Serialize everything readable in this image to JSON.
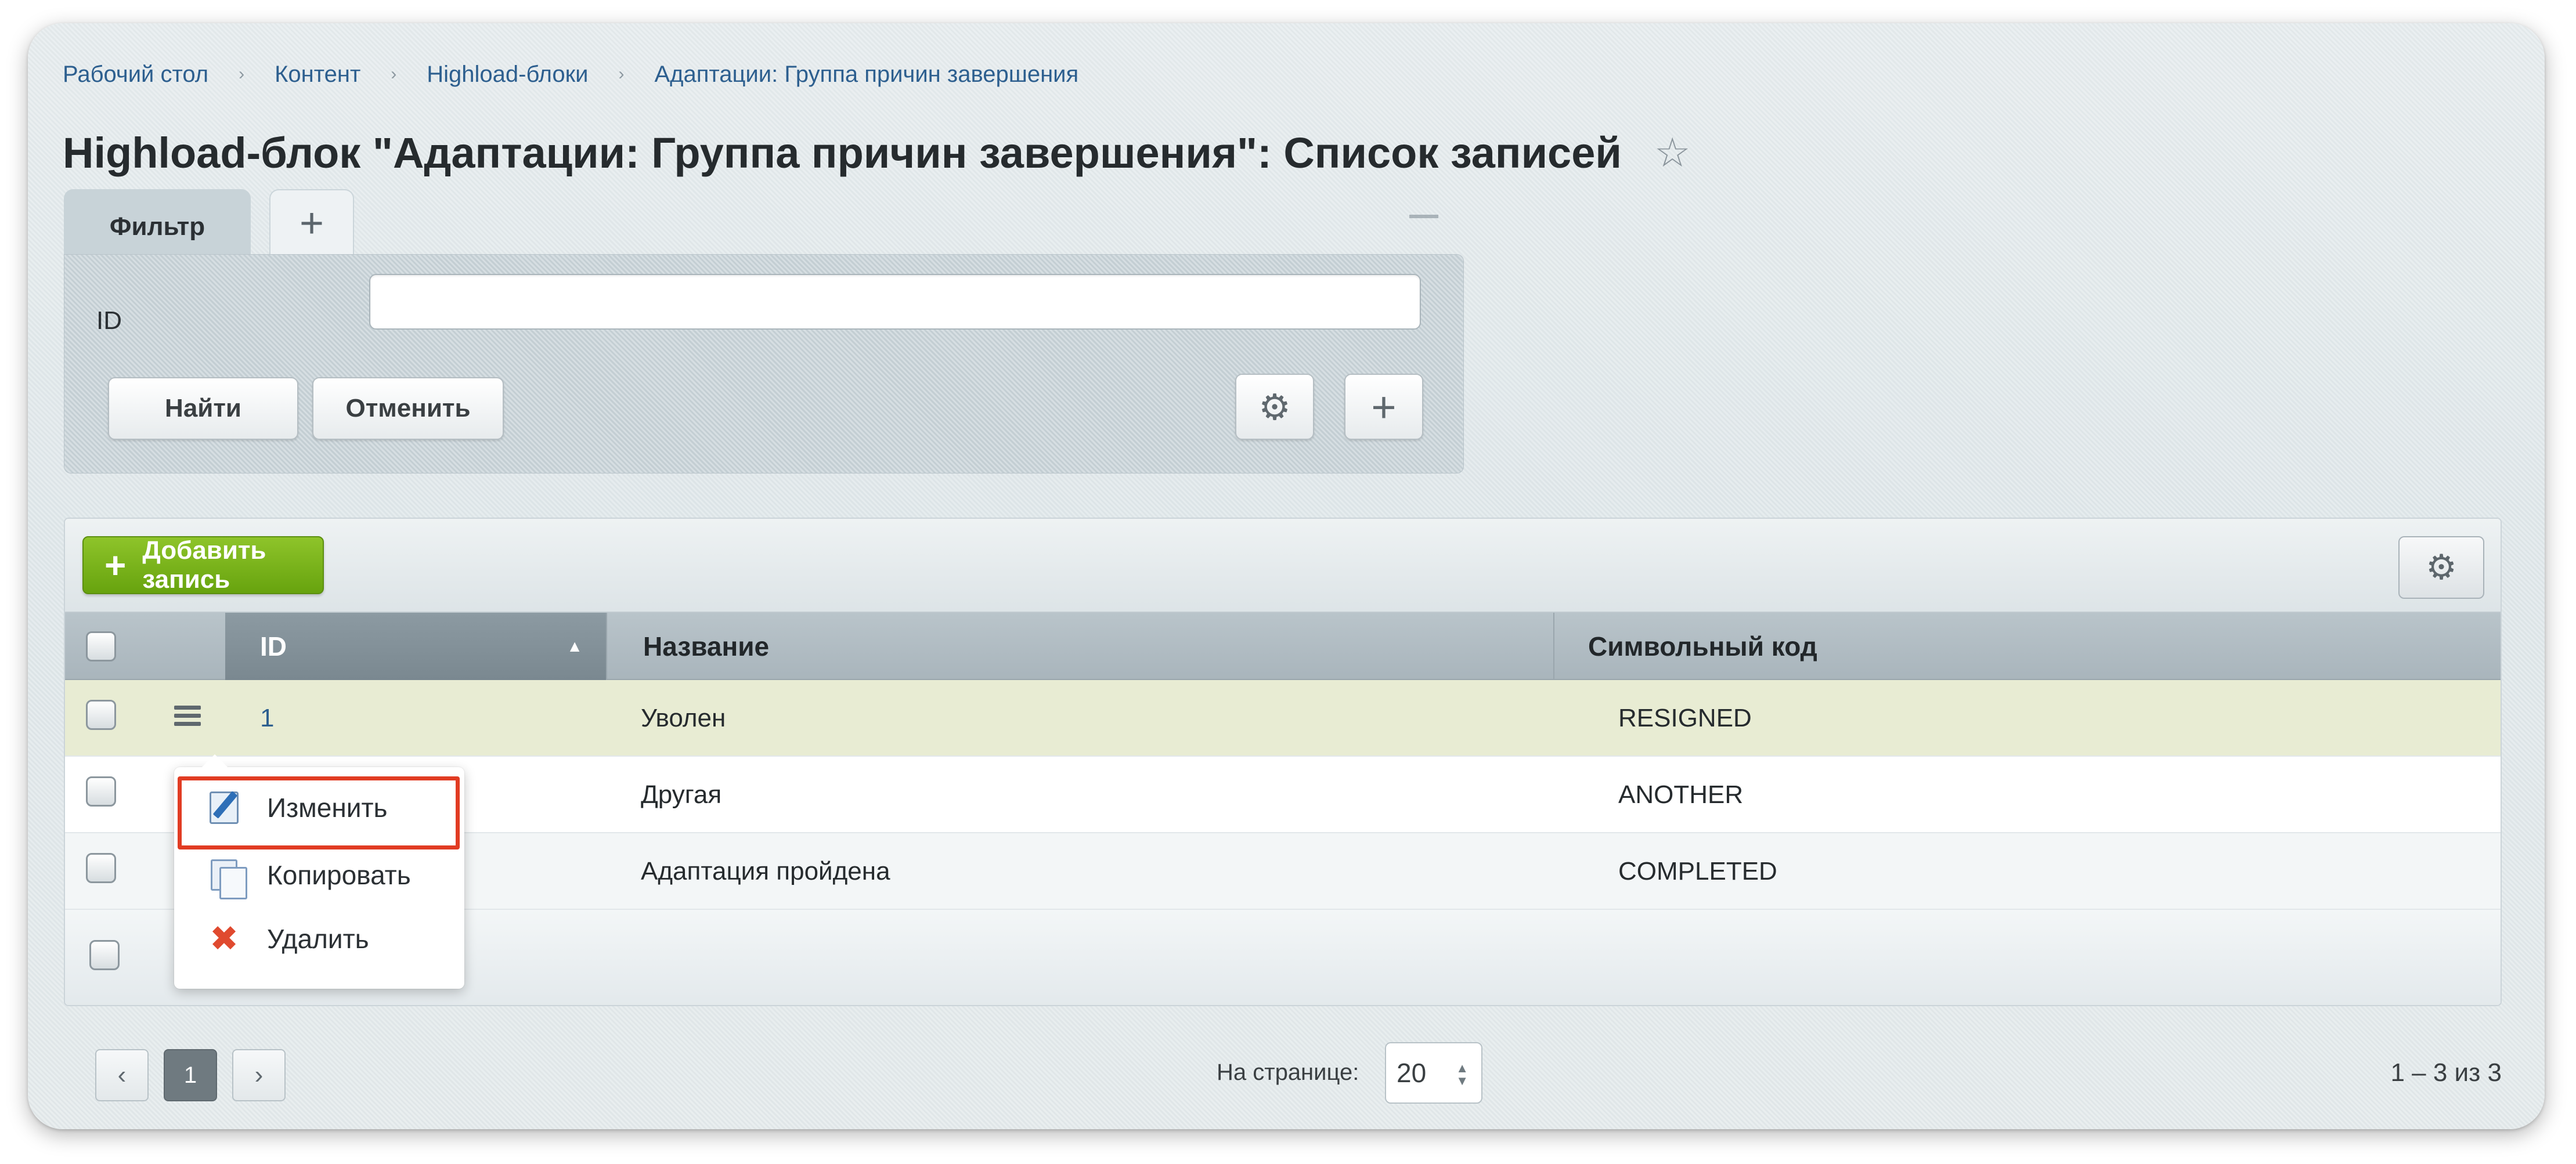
{
  "breadcrumbs": {
    "items": [
      "Рабочий стол",
      "Контент",
      "Highload-блоки",
      "Адаптации: Группа причин завершения"
    ],
    "separator": "›"
  },
  "page": {
    "title": "Highload-блок \"Адаптации: Группа причин завершения\": Список записей",
    "star_icon": "☆"
  },
  "filter": {
    "tab_label": "Фильтр",
    "add_tab_icon": "+",
    "field_label": "ID",
    "id_value": "",
    "find_label": "Найти",
    "cancel_label": "Отменить",
    "gear_icon": "⚙",
    "plus_icon": "+"
  },
  "list": {
    "add_button_icon": "+",
    "add_button_label": "Добавить запись",
    "settings_icon": "⚙",
    "columns": {
      "id": "ID",
      "name": "Название",
      "code": "Символьный код"
    },
    "sort_arrow": "▲",
    "rows": [
      {
        "id": "1",
        "name": "Уволен",
        "code": "RESIGNED"
      },
      {
        "id": "",
        "name": "Другая",
        "code": "ANOTHER"
      },
      {
        "id": "",
        "name": "Адаптация пройдена",
        "code": "COMPLETED"
      }
    ]
  },
  "context_menu": {
    "items": [
      {
        "label": "Изменить",
        "icon": "edit-icon"
      },
      {
        "label": "Копировать",
        "icon": "copy-icon"
      },
      {
        "label": "Удалить",
        "icon": "delete-icon",
        "glyph": "✖"
      }
    ],
    "highlight_color": "#e13c23"
  },
  "pagination": {
    "prev_icon": "‹",
    "current_page": "1",
    "next_icon": "›",
    "per_page_label": "На странице:",
    "per_page_value": "20",
    "select_arrows": "▲▼",
    "count_text": "1 – 3 из 3"
  },
  "colors": {
    "accent_green": "#6aa513",
    "link_blue": "#2d5f8f",
    "selected_row": "#e8ecd3"
  }
}
